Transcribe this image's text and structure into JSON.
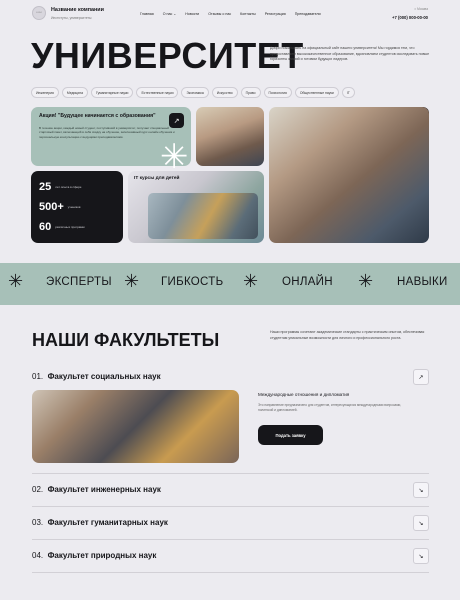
{
  "header": {
    "logo_text": "LOGO",
    "company_name": "Название компании",
    "company_sub": "Институты, университеты",
    "nav": [
      "Главная",
      "О нас ⌄",
      "Новости",
      "Отзывы о нас",
      "Контакты",
      "Регистрация",
      "Преподаватели"
    ],
    "city": "г. Москва",
    "phone": "+7 (000) 000-00-00"
  },
  "hero": {
    "title": "УНИВЕРСИТЕТ",
    "description": "Добро пожаловать на официальный сайт нашего университета! Мы гордимся тем, что предоставляем высококачественное образование, вдохновляем студентов исследовать новые горизонты знаний и готовим будущих лидеров.",
    "tags": [
      "Инженерия",
      "Медицина",
      "Гуманитарные науки",
      "Естественные науки",
      "Экономика",
      "Искусство",
      "Право",
      "Психология",
      "Общественные науки",
      "IT"
    ],
    "cta_label": "Подать заявку"
  },
  "promo": {
    "title": "Акция! \"Будущее начинается с образования\"",
    "text": "В течение акции, каждый новый студент, поступивший в университет, получает специальный стартовый пакет, включающий в себя скидку на обучение, эксклюзивный курс онлайн обучения и персональную консультацию с ведущими преподавателями.",
    "arrow": "↗"
  },
  "stats": [
    {
      "value": "25",
      "label": "лет опыта в сфере"
    },
    {
      "value": "500+",
      "label": "учеников"
    },
    {
      "value": "60",
      "label": "различных программ"
    }
  ],
  "it_card": {
    "label": "IT курсы для детей"
  },
  "ticker": {
    "items": [
      "ЭКСПЕРТЫ",
      "ГИБКОСТЬ",
      "ОНЛАЙН",
      "НАВЫКИ"
    ],
    "symbol": "✳"
  },
  "faculties": {
    "title": "НАШИ ФАКУЛЬТЕТЫ",
    "description": "Наши программы сочетают академические стандарты с практическим опытом, обеспечивая студентам уникальные возможности для личного и профессионального роста.",
    "items": [
      {
        "num": "01.",
        "name": "Факультет социальных наук",
        "icon": "↗"
      },
      {
        "num": "02.",
        "name": "Факультет инженерных наук",
        "icon": "↘"
      },
      {
        "num": "03.",
        "name": "Факультет гуманитарных наук",
        "icon": "↘"
      },
      {
        "num": "04.",
        "name": "Факультет природных наук",
        "icon": "↘"
      }
    ],
    "expanded": {
      "subtitle": "Международные отношения и дипломатия",
      "text": "Это направление предназначено для студентов, интересующихся международными вопросами, политикой и дипломатией.",
      "cta_label": "Подать заявку"
    }
  },
  "colors": {
    "accent": "#a7c0b8",
    "dark": "#16161a",
    "background": "#ecebf0"
  }
}
